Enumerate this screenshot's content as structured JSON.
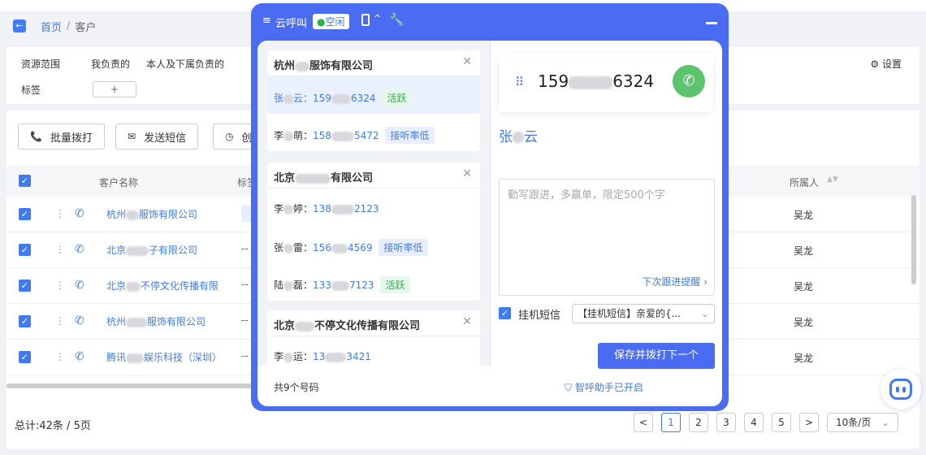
{
  "breadcrumb": {
    "home": "首页",
    "sep": "/",
    "current": "客户"
  },
  "filters": {
    "scope_label": "资源范围",
    "scope_options": [
      "我负责的",
      "本人及下属负责的"
    ],
    "tag_label": "标签",
    "tag_add": "+",
    "settings": "设置"
  },
  "toolbar": {
    "batch_dial": "批量拨打",
    "send_sms": "发送短信",
    "third": "创"
  },
  "table": {
    "col_name": "客户名称",
    "col_tag": "标签",
    "col_owner": "所属人",
    "rows": [
      {
        "name_a": "杭州",
        "name_b": "服饰有限公司",
        "tag": "",
        "owner": "吴龙"
      },
      {
        "name_a": "北京",
        "name_b": "子有限公司",
        "tag": "--",
        "owner": "吴龙"
      },
      {
        "name_a": "北京",
        "name_b": "不停文化传播有限",
        "tag": "--",
        "owner": "吴龙"
      },
      {
        "name_a": "杭州",
        "name_b": "服饰有限公司",
        "tag": "--",
        "owner": "吴龙"
      },
      {
        "name_a": "腾讯",
        "name_b": "娱乐科技（深圳）",
        "tag": "--",
        "owner": "吴龙"
      }
    ]
  },
  "pagination": {
    "total": "总计:42条 / 5页",
    "prev": "<",
    "pages": [
      "1",
      "2",
      "3",
      "4",
      "5"
    ],
    "next": ">",
    "page_size": "10条/页"
  },
  "dialer": {
    "title": "云呼叫",
    "status": "空闲",
    "groups": [
      {
        "company_a": "杭州",
        "company_b": "服饰有限公司",
        "close": "✕",
        "contacts": [
          {
            "name_a": "张",
            "name_b": "云：",
            "phone_a": "159",
            "phone_b": "6324",
            "badge": "活跃",
            "badge_type": "green",
            "selected": true
          },
          {
            "name_a": "李",
            "name_b": "萌：",
            "phone_a": "158",
            "phone_b": "5472",
            "badge": "接听率低",
            "badge_type": "blue",
            "selected": false
          }
        ]
      },
      {
        "company_a": "北京",
        "company_b": "有限公司",
        "close": "✕",
        "contacts": [
          {
            "name_a": "李",
            "name_b": "婷：",
            "phone_a": "138",
            "phone_b": "2123",
            "badge": "",
            "badge_type": "",
            "selected": false
          },
          {
            "name_a": "张",
            "name_b": "雷：",
            "phone_a": "156",
            "phone_b": "4569",
            "badge": "接听率低",
            "badge_type": "blue",
            "selected": false
          },
          {
            "name_a": "陆",
            "name_b": "磊：",
            "phone_a": "133",
            "phone_b": "7123",
            "badge": "活跃",
            "badge_type": "green",
            "selected": false
          }
        ]
      },
      {
        "company_a": "北京",
        "company_b": "不停文化传播有限公司",
        "close": "✕",
        "contacts": [
          {
            "name_a": "李",
            "name_b": "运：",
            "phone_a": "13",
            "phone_b": "3421",
            "badge": "",
            "badge_type": "",
            "selected": false
          }
        ]
      }
    ],
    "footer_count": "共9个号码",
    "assistant": "智呼助手已开启",
    "number_a": "159",
    "number_b": "6324",
    "contact_name_a": "张",
    "contact_name_b": "云",
    "note_placeholder": "勤写跟进，多赢单，限定500个字",
    "next_reminder": "下次跟进提醒",
    "sms_label": "挂机短信",
    "sms_template": "【挂机短信】亲爱的{...",
    "save_next": "保存并拨打下一个"
  },
  "colors": {
    "accent": "#4a6cf2",
    "link": "#3f7bf5",
    "call_green": "#5bc46d"
  }
}
